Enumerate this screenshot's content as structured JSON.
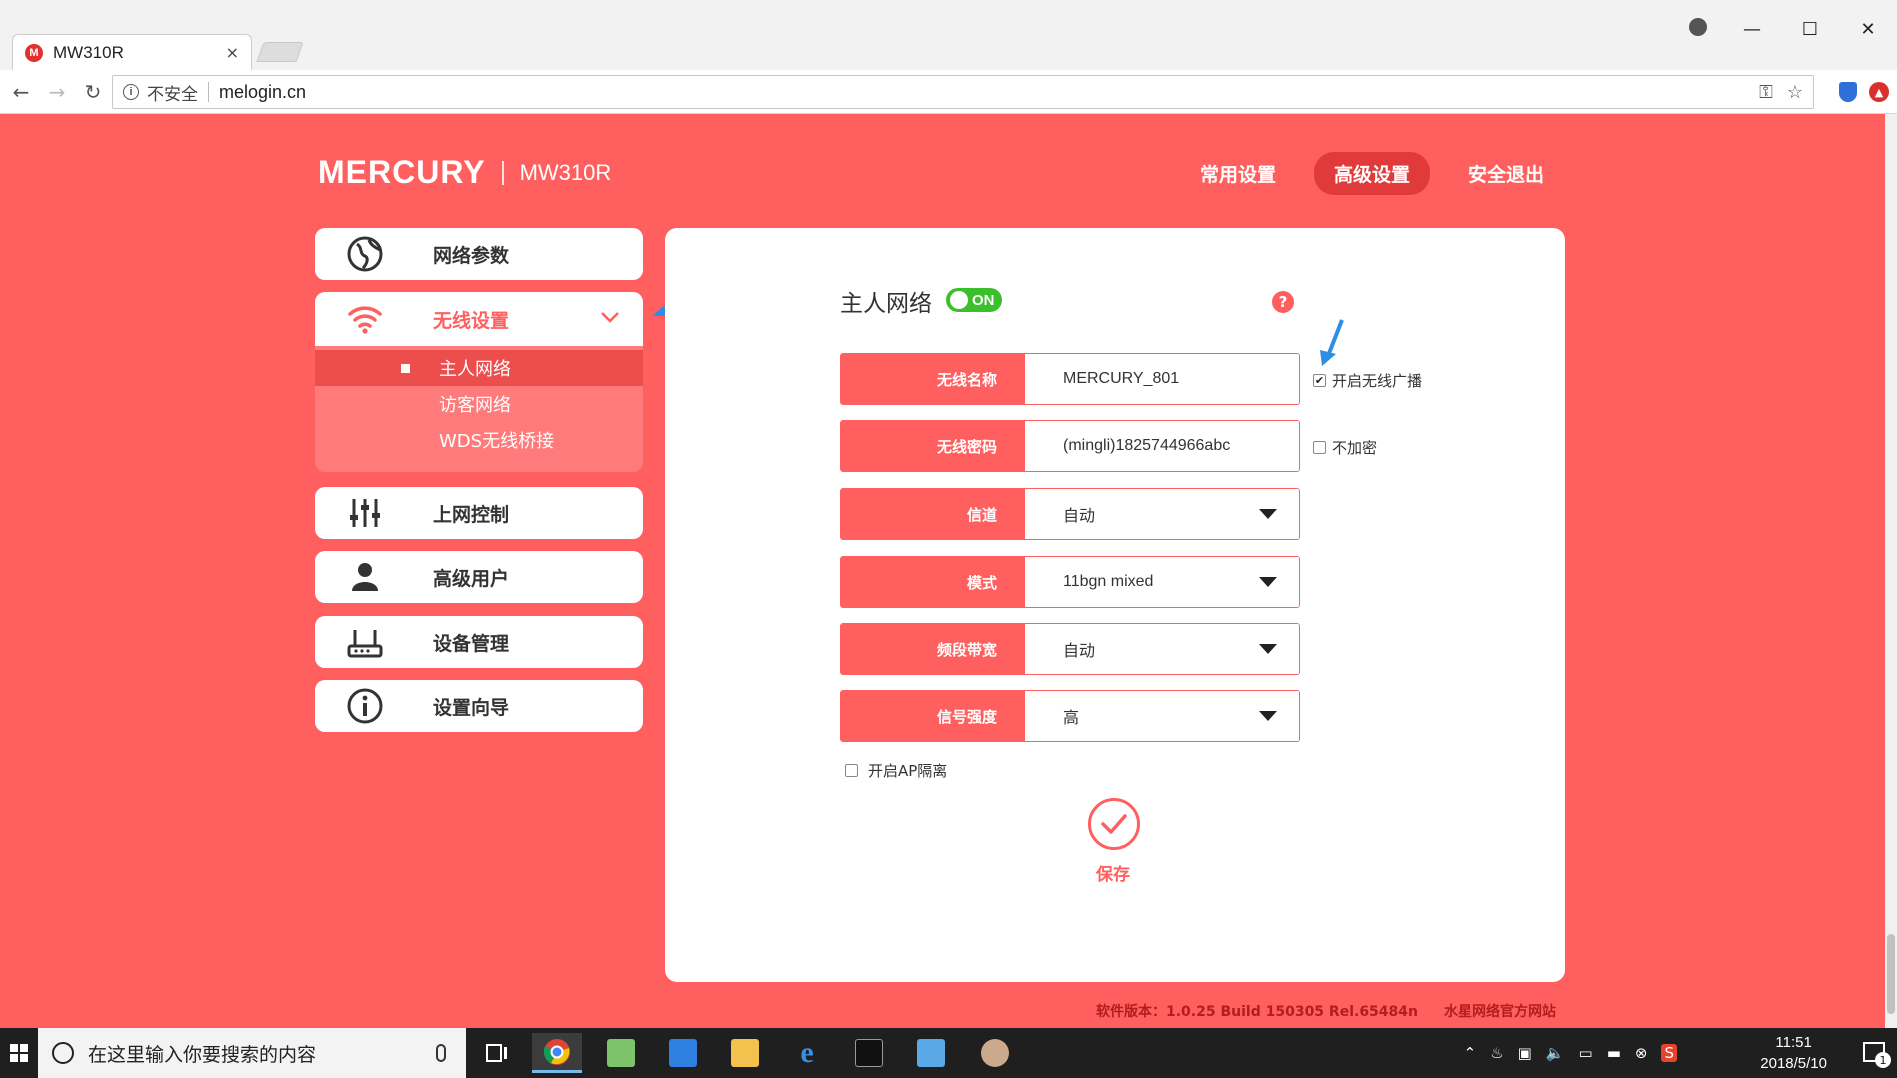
{
  "browser": {
    "tab_title": "MW310R",
    "tab_favicon": "M",
    "security_label": "不安全",
    "url": "melogin.cn"
  },
  "header": {
    "brand": "MERCURY",
    "model": "MW310R",
    "nav": [
      {
        "label": "常用设置",
        "active": false
      },
      {
        "label": "高级设置",
        "active": true
      },
      {
        "label": "安全退出",
        "active": false
      }
    ]
  },
  "sidebar": {
    "items": [
      {
        "label": "网络参数",
        "icon": "globe-icon"
      },
      {
        "label": "无线设置",
        "icon": "wifi-icon",
        "active": true
      },
      {
        "label": "上网控制",
        "icon": "sliders-icon"
      },
      {
        "label": "高级用户",
        "icon": "user-icon"
      },
      {
        "label": "设备管理",
        "icon": "router-icon"
      },
      {
        "label": "设置向导",
        "icon": "info-icon"
      }
    ],
    "submenu": [
      {
        "label": "主人网络",
        "active": true
      },
      {
        "label": "访客网络"
      },
      {
        "label": "WDS无线桥接"
      }
    ]
  },
  "content": {
    "title": "主人网络",
    "toggle_label": "ON",
    "help": "?",
    "fields": [
      {
        "label": "无线名称",
        "value": "MERCURY_801",
        "type": "input"
      },
      {
        "label": "无线密码",
        "value": "(mingli)1825744966abc",
        "type": "input"
      },
      {
        "label": "信道",
        "value": "自动",
        "type": "select"
      },
      {
        "label": "模式",
        "value": "11bgn mixed",
        "type": "select"
      },
      {
        "label": "频段带宽",
        "value": "自动",
        "type": "select"
      },
      {
        "label": "信号强度",
        "value": "高",
        "type": "select"
      }
    ],
    "broadcast_label": "开启无线广播",
    "broadcast_checked": true,
    "no_encrypt_label": "不加密",
    "no_encrypt_checked": false,
    "ap_isolation_label": "开启AP隔离",
    "ap_isolation_checked": false,
    "save_label": "保存"
  },
  "footer": {
    "version": "软件版本：1.0.25 Build 150305 Rel.65484n",
    "link": "水星网络官方网站"
  },
  "taskbar": {
    "search_placeholder": "在这里输入你要搜索的内容",
    "time": "11:51",
    "date": "2018/5/10",
    "notification_count": "1"
  },
  "colors": {
    "brand_red": "#ff5f5f",
    "toggle_green": "#3bbf2b",
    "annotation_blue": "#2f8de4"
  }
}
